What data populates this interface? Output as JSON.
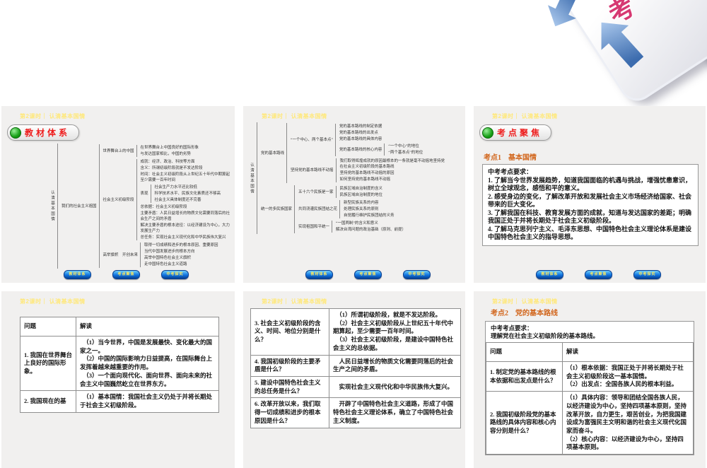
{
  "page": {
    "slide_header": "第2课时｜ 认清基本国情"
  },
  "deco": {
    "char": "考",
    "arrow_blue": "#3c6cae",
    "purple": "#473a9c",
    "pink": "#d63972"
  },
  "nav_buttons": [
    "教材体系",
    "考点聚焦",
    "中考探究"
  ],
  "slides": {
    "s1": {
      "badge": "教材体系",
      "tree": {
        "t": "认清基本国情",
        "v": 1,
        "c": [
          {
            "t": "我们的社会主义祖国",
            "c": [
              {
                "t": "世界舞台上的中国",
                "c": [
                  {
                    "t": "在世界舞台上中国良好的国际形象"
                  },
                  {
                    "t": "与发达国家相比，中国的劣势"
                  }
                ]
              },
              {
                "t": "社会主义初级阶段",
                "c": [
                  {
                    "t": "成就：经济、政治、科技等方面"
                  },
                  {
                    "t": "含义：所谓初级阶段就是不发达阶段"
                  },
                  {
                    "t": "时间：社会主义初级阶段从上世纪五十年代中期算起至少需要一百年时间"
                  },
                  {
                    "t": "表现",
                    "c": [
                      {
                        "t": "社会生产力水平还比较低"
                      },
                      {
                        "t": "科学技术水平、民族文化素质还不够高"
                      },
                      {
                        "t": "社会主义具体制度还不完善"
                      }
                    ]
                  },
                  {
                    "t": "总依据：社会主义初级阶段"
                  },
                  {
                    "t": "主要矛盾：人民日益增长的物质文化需要同落后的社会生产之间的矛盾"
                  },
                  {
                    "t": "解决主要矛盾的根本途径：以经济建设为中心，大力发展生产力"
                  },
                  {
                    "t": "总任务：实现社会主义现代化和中华民族伟大复兴"
                  }
                ]
              },
              {
                "t": "高举旗帜　开创未来",
                "c": [
                  {
                    "t": "取得一切成绩和进步的根本原因、重要原因"
                  },
                  {
                    "t": "当代中国发展进步的根本方向"
                  },
                  {
                    "t": "高举中国特色社会主义旗帜"
                  },
                  {
                    "t": "走中国特色社会主义道路"
                  }
                ]
              }
            ]
          }
        ]
      }
    },
    "s2": {
      "tree": {
        "t": "认清基本国情",
        "v": 1,
        "c": [
          {
            "t": "党的基本路线",
            "c": [
              {
                "t": "“一个中心、两个基本点”",
                "c": [
                  {
                    "t": "党的基本路线的制定依据"
                  },
                  {
                    "t": "党的基本路线的出发点"
                  },
                  {
                    "t": "党的基本路线的具体内容"
                  },
                  {
                    "t": "党的基本路线的核心内容",
                    "c": [
                      {
                        "t": "“一个中心”的地位"
                      },
                      {
                        "t": "“两个基本点”的地位"
                      }
                    ]
                  }
                ]
              },
              {
                "t": "坚持党的基本路线不动摇",
                "c": [
                  {
                    "t": "我们取得辉煌成就的原因最根本的一条就是毫不动摇地坚持党在社会主义初级阶段的基本路线"
                  },
                  {
                    "t": "坚持党的基本路线不动摇的原因"
                  },
                  {
                    "t": "如何坚持党的基本路线不动摇"
                  }
                ]
              }
            ]
          },
          {
            "t": "统一的多民族国家",
            "c": [
              {
                "t": "五十六个民族是一家",
                "c": [
                  {
                    "t": "民族区域自治制度的含义"
                  },
                  {
                    "t": "民族区域自治制度的地位"
                  }
                ]
              },
              {
                "t": "共同浇灌民族团结之花",
                "c": [
                  {
                    "t": "新型民族关系的内容"
                  },
                  {
                    "t": "处理民族关系的原则"
                  },
                  {
                    "t": "自觉履行维护民族团结的义务"
                  }
                ]
              },
              {
                "t": "实现祖国和平统一",
                "c": [
                  {
                    "t": "“一国两制”的含义和意义"
                  },
                  {
                    "t": "解决台湾问题的政治基础（原则、前提）"
                  }
                ]
              }
            ]
          }
        ]
      }
    },
    "s3": {
      "badge": "考点聚焦",
      "heading": "考点1　基本国情",
      "req_lines": [
        "中考考点要求：",
        "1. 了解当今世界发展趋势，知道我国面临的机遇与挑战，增强忧患意识，树立全球观念，感悟和平的意义。",
        "2. 感受身边的变化，了解改革开放和发展社会主义市场经济给国家、社会带来的巨大变化。",
        "3. 了解我国在科技、教育发展方面的成就，知道与发达国家的差距；明确我国正处于并将长期处于社会主义初级阶段。",
        "4. 了解马克思列宁主义、毛泽东思想、中国特色社会主义理论体系是建设中国特色社会主义的指导思想。"
      ]
    },
    "s4": {
      "table": {
        "widths": [
          79,
          0
        ],
        "header": [
          "问题",
          "解读"
        ],
        "rows": [
          [
            "1. 我国在世界舞台上良好的国际形象。",
            "　（1）当今世界，中国是发展最快、变化最大的国家之一。\n　（2）中国的国际影响力日益提高，在国际舞台上发挥着越来越重要的作用。\n　（3）一个面向现代化、面向世界、面向未来的社会主义中国巍然屹立在世界东方。"
          ],
          [
            "2. 我国现在的基",
            "　（1）基本国情：我国社会主义仍处于并将长期处于社会主义初级阶段。"
          ]
        ]
      }
    },
    "s5": {
      "table": {
        "widths": [
          111,
          0
        ],
        "rows": [
          [
            "3. 社会主义初级阶段的含义、时间、地位分别是什么？",
            "　（1）所谓初级阶段，就是不发达阶段。\n　（2）社会主义初级阶段从上世纪五十年代中期算起，至少需要一百年时间。\n　（3）社会主义初级阶段，是建设中国特色社会主义的总依据。"
          ],
          [
            "4. 我国初级阶段的主要矛盾是什么？",
            "　人民日益增长的物质文化需要同落后的社会生产之间的矛盾。"
          ],
          [
            "5. 建设中国特色社会主义的总任务是什么？",
            "　实现社会主义现代化和中华民族伟大复兴。"
          ],
          [
            "6. 改革开放以来，我们取得一切成绩和进步的根本原因是什么？",
            "　开辟了中国特色社会主义道路，形成了中国特色社会主义理论体系，确立了中国特色社会主义制度。"
          ]
        ]
      }
    },
    "s6": {
      "heading": "考点2　党的基本路线",
      "req_lines": [
        "中考考点要求：",
        "理解党在社会主义初级阶段的基本路线。"
      ],
      "table": {
        "widths": [
          108,
          0
        ],
        "header": [
          "问题",
          "解读"
        ],
        "rows": [
          [
            "1. 制定党的基本路线的根本依据和出发点是什么？",
            "（1）根本依据：我国正处于并将长期处于社会主义初级阶段这一基本国情。\n（2）出发点：全国各族人民的根本利益。"
          ],
          [
            "2. 我国初级阶段党的基本路线的具体内容和核心内容分别是什么？",
            "（1）具体内容：领导和团结全国各族人民，以经济建设为中心，坚持四项基本原则，坚持改革开放，自力更生，艰苦创业，为把我国建设成为富强民主文明和谐的社会主义现代化国家而奋斗。\n（2）核心内容：以经济建设为中心，坚持四项基本原则。"
          ]
        ]
      }
    }
  }
}
